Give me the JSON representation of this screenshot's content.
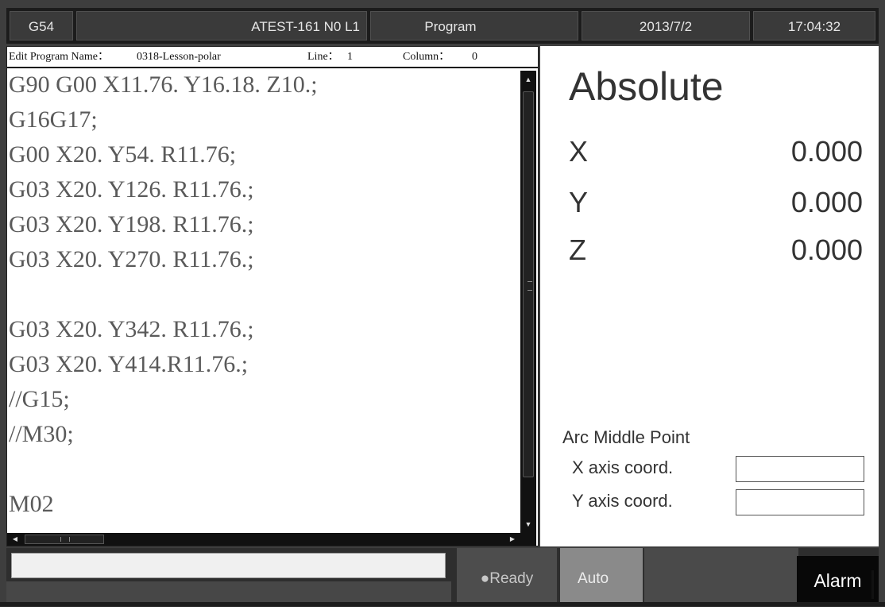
{
  "header": {
    "wcs": "G54",
    "program_info": "ATEST-161 N0 L1",
    "mode": "Program",
    "date": "2013/7/2",
    "time": "17:04:32"
  },
  "editor": {
    "program_label": "Edit Program Name：",
    "program_name": "0318-Lesson-polar",
    "line_label": "Line：",
    "line_value": "1",
    "column_label": "Column：",
    "column_value": "0",
    "lines": [
      "G90 G00 X11.76. Y16.18. Z10.;",
      "G16G17;",
      "G00 X20. Y54. R11.76;",
      "G03 X20. Y126. R11.76.;",
      "G03 X20. Y198. R11.76.;",
      "G03 X20. Y270. R11.76.;",
      "",
      "G03 X20. Y342. R11.76.;",
      "G03 X20. Y414.R11.76.;",
      "//G15;",
      "//M30;",
      "",
      "M02"
    ]
  },
  "status": {
    "coord_mode": "Absolute",
    "axes": [
      {
        "name": "X",
        "value": "0.000"
      },
      {
        "name": "Y",
        "value": "0.000"
      },
      {
        "name": "Z",
        "value": "0.000"
      }
    ],
    "arc_title": "Arc Middle Point",
    "arc_x_label": "X axis coord.",
    "arc_y_label": "Y axis coord.",
    "arc_x_value": "",
    "arc_y_value": ""
  },
  "footer": {
    "message": "",
    "ready": "●Ready",
    "auto": "Auto",
    "alarm": "Alarm"
  }
}
